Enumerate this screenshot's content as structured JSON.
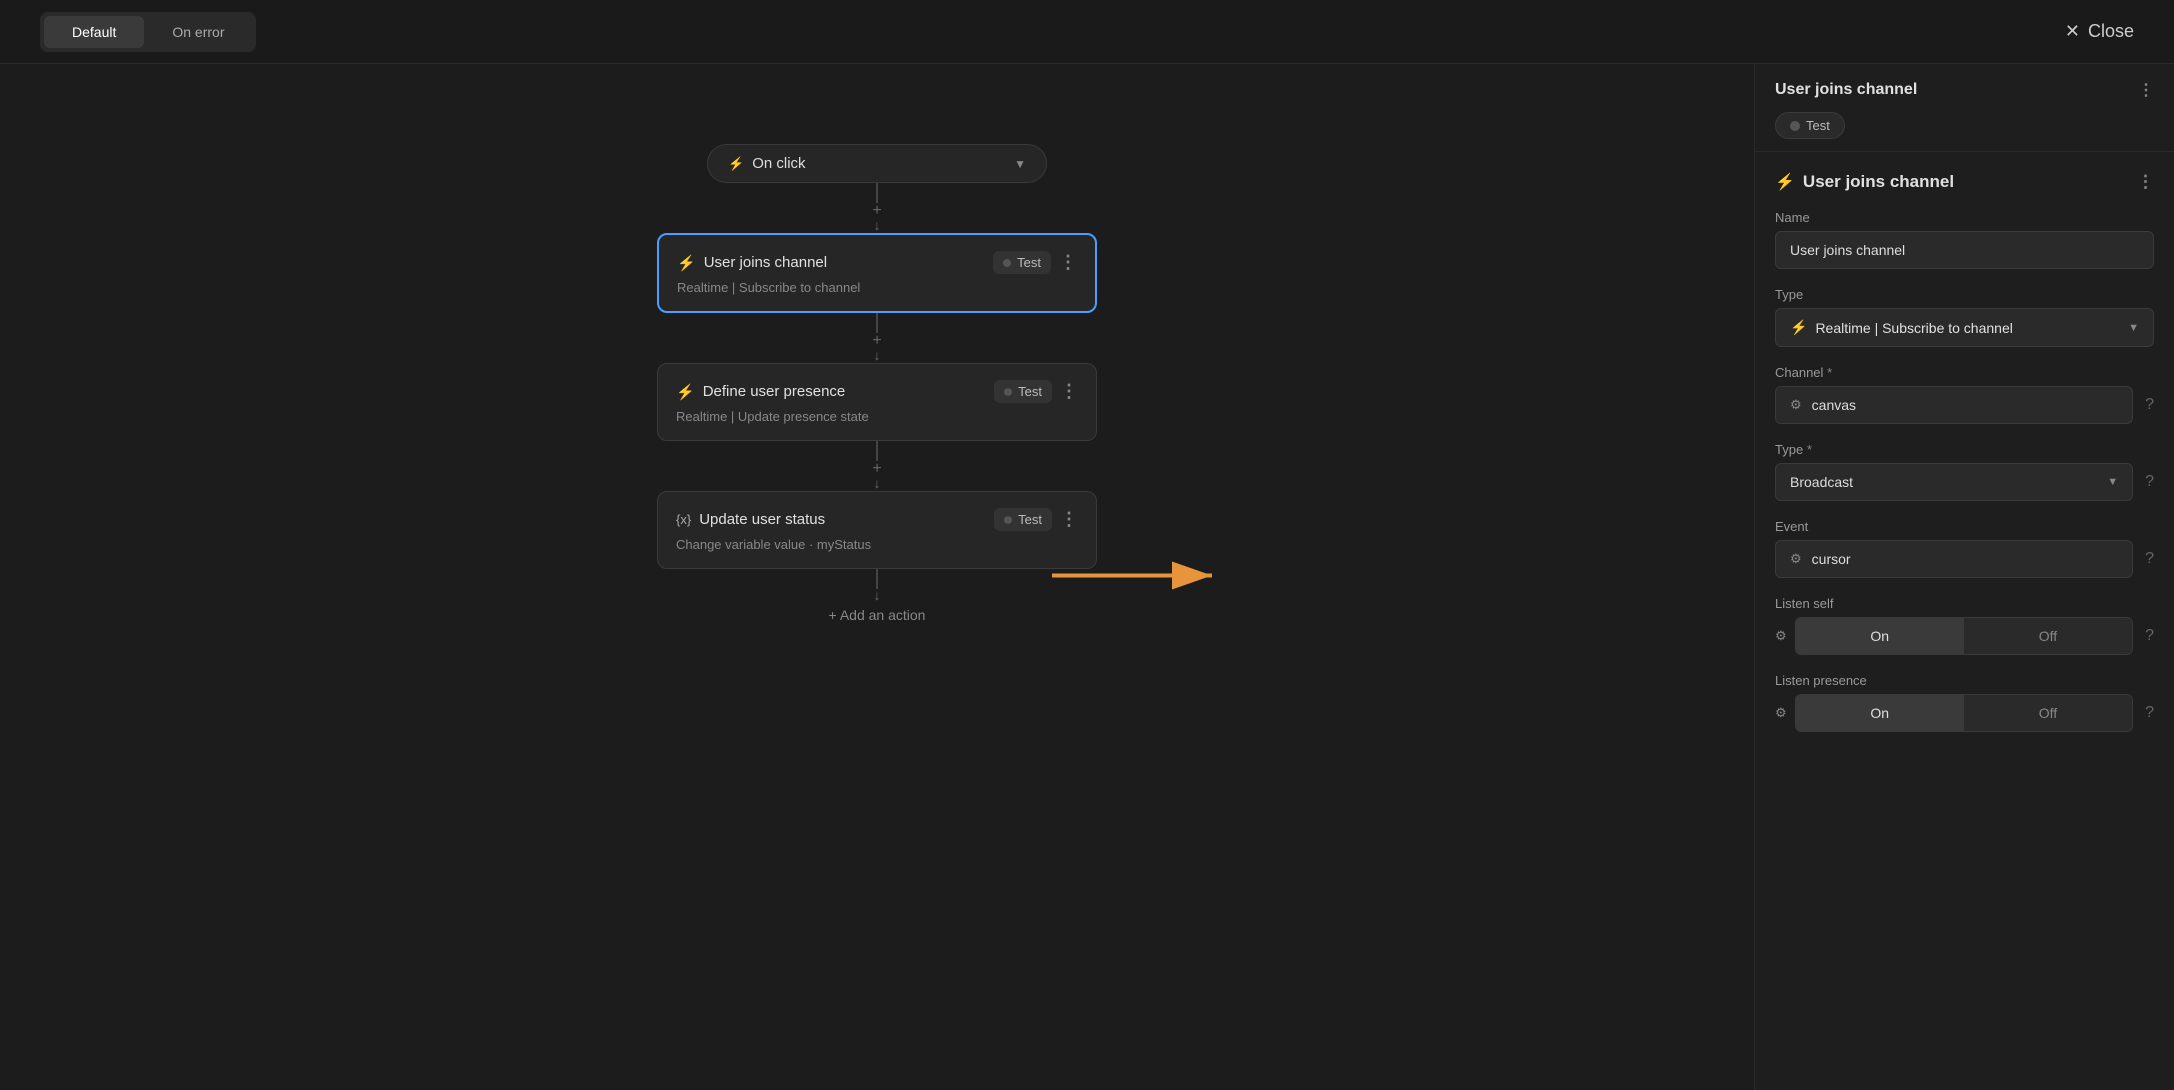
{
  "topbar": {
    "tabs": [
      {
        "label": "Default",
        "active": true
      },
      {
        "label": "On error",
        "active": false
      }
    ],
    "close_label": "Close"
  },
  "canvas": {
    "trigger": {
      "icon": "⚡",
      "label": "On click"
    },
    "nodes": [
      {
        "id": "node1",
        "title": "User joins channel",
        "subtitle": "Realtime | Subscribe to channel",
        "badge": "Test",
        "selected": true
      },
      {
        "id": "node2",
        "title": "Define user presence",
        "subtitle": "Realtime | Update presence state",
        "badge": "Test",
        "selected": false
      },
      {
        "id": "node3",
        "title": "Update user status",
        "subtitle": "Change variable value · myStatus",
        "badge": "Test",
        "selected": false
      }
    ],
    "add_action_label": "+ Add an action"
  },
  "panel": {
    "top_title": "User joins channel",
    "test_label": "Test",
    "detail_title": "User joins channel",
    "name_label": "Name",
    "name_value": "User joins channel",
    "type_label": "Type",
    "type_value": "Realtime | Subscribe to channel",
    "channel_label": "Channel",
    "channel_required": "*",
    "channel_value": "canvas",
    "type2_label": "Type",
    "type2_required": "*",
    "type2_value": "Broadcast",
    "event_label": "Event",
    "event_value": "cursor",
    "listen_self_label": "Listen self",
    "listen_self_on": "On",
    "listen_self_off": "Off",
    "listen_presence_label": "Listen presence",
    "listen_presence_on": "On",
    "listen_presence_off": "Off"
  }
}
